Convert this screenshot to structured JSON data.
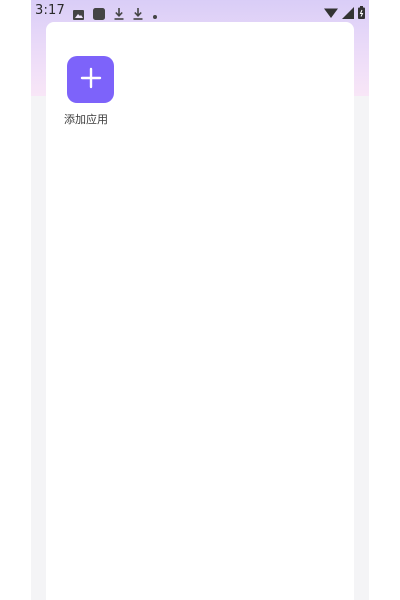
{
  "status_bar": {
    "time": "3:17",
    "left_icons": [
      "image-icon",
      "app-square-icon",
      "download-icon",
      "download-icon",
      "dot-icon"
    ],
    "right_icons": [
      "wifi-icon",
      "signal-icon",
      "battery-icon"
    ]
  },
  "content": {
    "add_app": {
      "label": "添加应用",
      "icon": "plus-icon"
    }
  },
  "colors": {
    "accent": "#7d63fa",
    "header_gradient_top": "#d9cdf7",
    "header_gradient_bottom": "#f8e6f7",
    "background": "#f4f4f6",
    "card": "#ffffff"
  }
}
